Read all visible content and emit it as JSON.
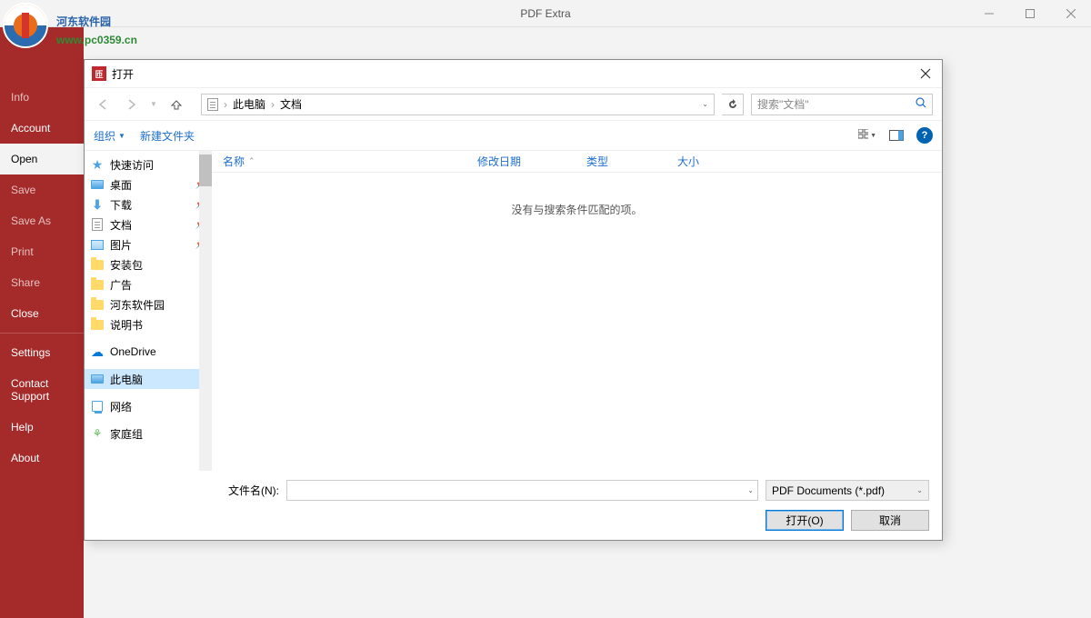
{
  "app": {
    "title": "PDF Extra"
  },
  "sidebar": {
    "items": [
      {
        "label": "Info",
        "enabled": false
      },
      {
        "label": "Account",
        "enabled": true
      },
      {
        "label": "Open",
        "enabled": true,
        "active": true
      },
      {
        "label": "Save",
        "enabled": false
      },
      {
        "label": "Save As",
        "enabled": false
      },
      {
        "label": "Print",
        "enabled": false
      },
      {
        "label": "Share",
        "enabled": false
      },
      {
        "label": "Close",
        "enabled": true
      },
      {
        "label": "Settings",
        "enabled": true
      },
      {
        "label": "Contact Support",
        "enabled": true
      },
      {
        "label": "Help",
        "enabled": true
      },
      {
        "label": "About",
        "enabled": true
      }
    ]
  },
  "dialog": {
    "title": "打开",
    "breadcrumb": {
      "items": [
        "此电脑",
        "文档"
      ]
    },
    "search_placeholder": "搜索\"文档\"",
    "toolbar": {
      "organize": "组织",
      "newfolder": "新建文件夹"
    },
    "columns": {
      "name": "名称",
      "date": "修改日期",
      "type": "类型",
      "size": "大小"
    },
    "empty_text": "没有与搜索条件匹配的项。",
    "tree": [
      {
        "label": "快速访问",
        "icon": "star"
      },
      {
        "label": "桌面",
        "icon": "monitor",
        "pin": true
      },
      {
        "label": "下载",
        "icon": "download",
        "pin": true
      },
      {
        "label": "文档",
        "icon": "doc",
        "pin": true
      },
      {
        "label": "图片",
        "icon": "pic",
        "pin": true
      },
      {
        "label": "安装包",
        "icon": "folder"
      },
      {
        "label": "广告",
        "icon": "folder"
      },
      {
        "label": "河东软件园",
        "icon": "folder"
      },
      {
        "label": "说明书",
        "icon": "folder"
      },
      {
        "label": "OneDrive",
        "icon": "cloud",
        "sep": true
      },
      {
        "label": "此电脑",
        "icon": "monitor",
        "sep": true,
        "selected": true
      },
      {
        "label": "网络",
        "icon": "network",
        "sep": true
      },
      {
        "label": "家庭组",
        "icon": "home",
        "sep": true
      }
    ],
    "filename_label": "文件名(N):",
    "filetype_value": "PDF Documents (*.pdf)",
    "open_btn": "打开(O)",
    "cancel_btn": "取消"
  },
  "watermark": {
    "line1": "河东软件园",
    "line2": "www.pc0359.cn"
  }
}
